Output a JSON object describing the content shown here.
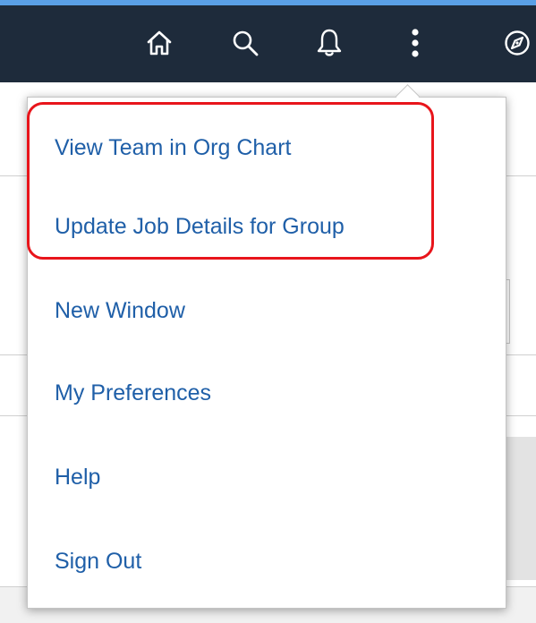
{
  "header": {
    "icons": [
      "home-icon",
      "search-icon",
      "bell-icon",
      "kebab-menu-icon",
      "compass-icon"
    ],
    "colors": {
      "bar": "#1e2b3b",
      "top_strip": "#5aa0e6",
      "icon": "#ffffff"
    }
  },
  "menu": {
    "items": [
      {
        "label": "View Team in Org Chart"
      },
      {
        "label": "Update Job Details for Group"
      },
      {
        "label": "New Window"
      },
      {
        "label": "My Preferences"
      },
      {
        "label": "Help"
      },
      {
        "label": "Sign Out"
      }
    ],
    "link_color": "#1f5fa8",
    "highlight_color": "#e8151b"
  }
}
